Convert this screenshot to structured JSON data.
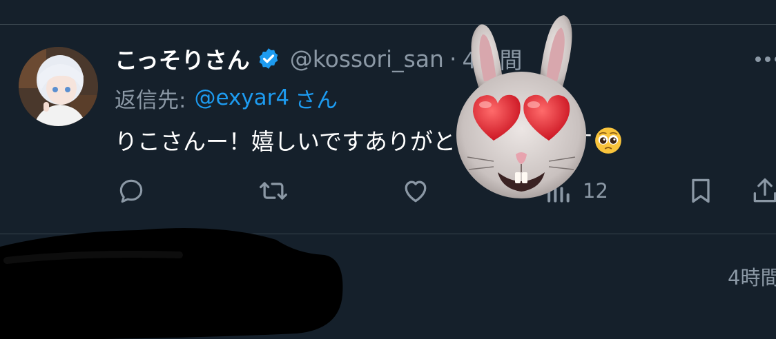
{
  "tweet": {
    "display_name": "こっそりさん",
    "handle": "@kossori_san",
    "separator": "·",
    "time": "4時間",
    "reply_label": "返信先:",
    "reply_user": "@exyar4",
    "reply_suffix": "さん",
    "text": "りこさんー！嬉しいですありがとうございます",
    "inline_emoji": "pleading-face-icon"
  },
  "actions": {
    "views_count": "12"
  },
  "next_tweet": {
    "time": "4時間"
  },
  "colors": {
    "background": "#15202b",
    "accent": "#1d9bf0",
    "muted": "#8b98a5",
    "divider": "#38444d"
  },
  "icons": [
    "verified-badge-icon",
    "reply-icon",
    "retweet-icon",
    "like-icon",
    "views-icon",
    "bookmark-icon",
    "share-icon",
    "more-icon",
    "bunny-heart-eyes-sticker",
    "pleading-face-icon"
  ]
}
